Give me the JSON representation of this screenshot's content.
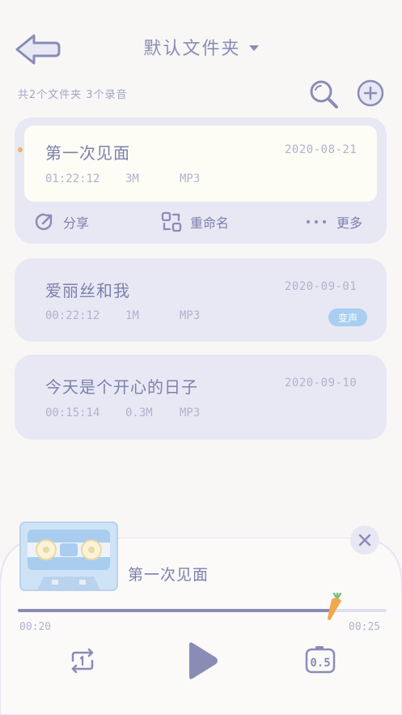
{
  "header": {
    "title": "默认文件夹",
    "summary": "共2个文件夹 3个录音"
  },
  "recordings": [
    {
      "name": "第一次见面",
      "date": "2020-08-21",
      "duration": "01:22:12",
      "size": "3M",
      "format": "MP3"
    },
    {
      "name": "爱丽丝和我",
      "date": "2020-09-01",
      "duration": "00:22:12",
      "size": "1M",
      "format": "MP3",
      "badge": "变声"
    },
    {
      "name": "今天是个开心的日子",
      "date": "2020-09-10",
      "duration": "00:15:14",
      "size": "0.3M",
      "format": "MP3"
    }
  ],
  "actions": {
    "share": "分享",
    "rename": "重命名",
    "more": "更多"
  },
  "player": {
    "title": "第一次见面",
    "elapsed": "00:20",
    "total": "00:25",
    "progress": 0.86,
    "speed_label": "0.5"
  },
  "colors": {
    "accent": "#8a8cb6",
    "card": "#e8e8f4",
    "active_card": "#fdfcf5",
    "badge": "#a8cef0",
    "dot": "#f1b25a"
  },
  "icons": {
    "back": "arrow-left-icon",
    "search": "search-icon",
    "add": "plus-circle-icon",
    "share": "share-icon",
    "rename": "rename-icon",
    "more": "dots-icon",
    "close": "close-icon",
    "repeat": "repeat-one-icon",
    "play": "play-icon",
    "speed": "speed-icon",
    "thumb": "carrot-icon",
    "cover": "cassette-icon"
  }
}
